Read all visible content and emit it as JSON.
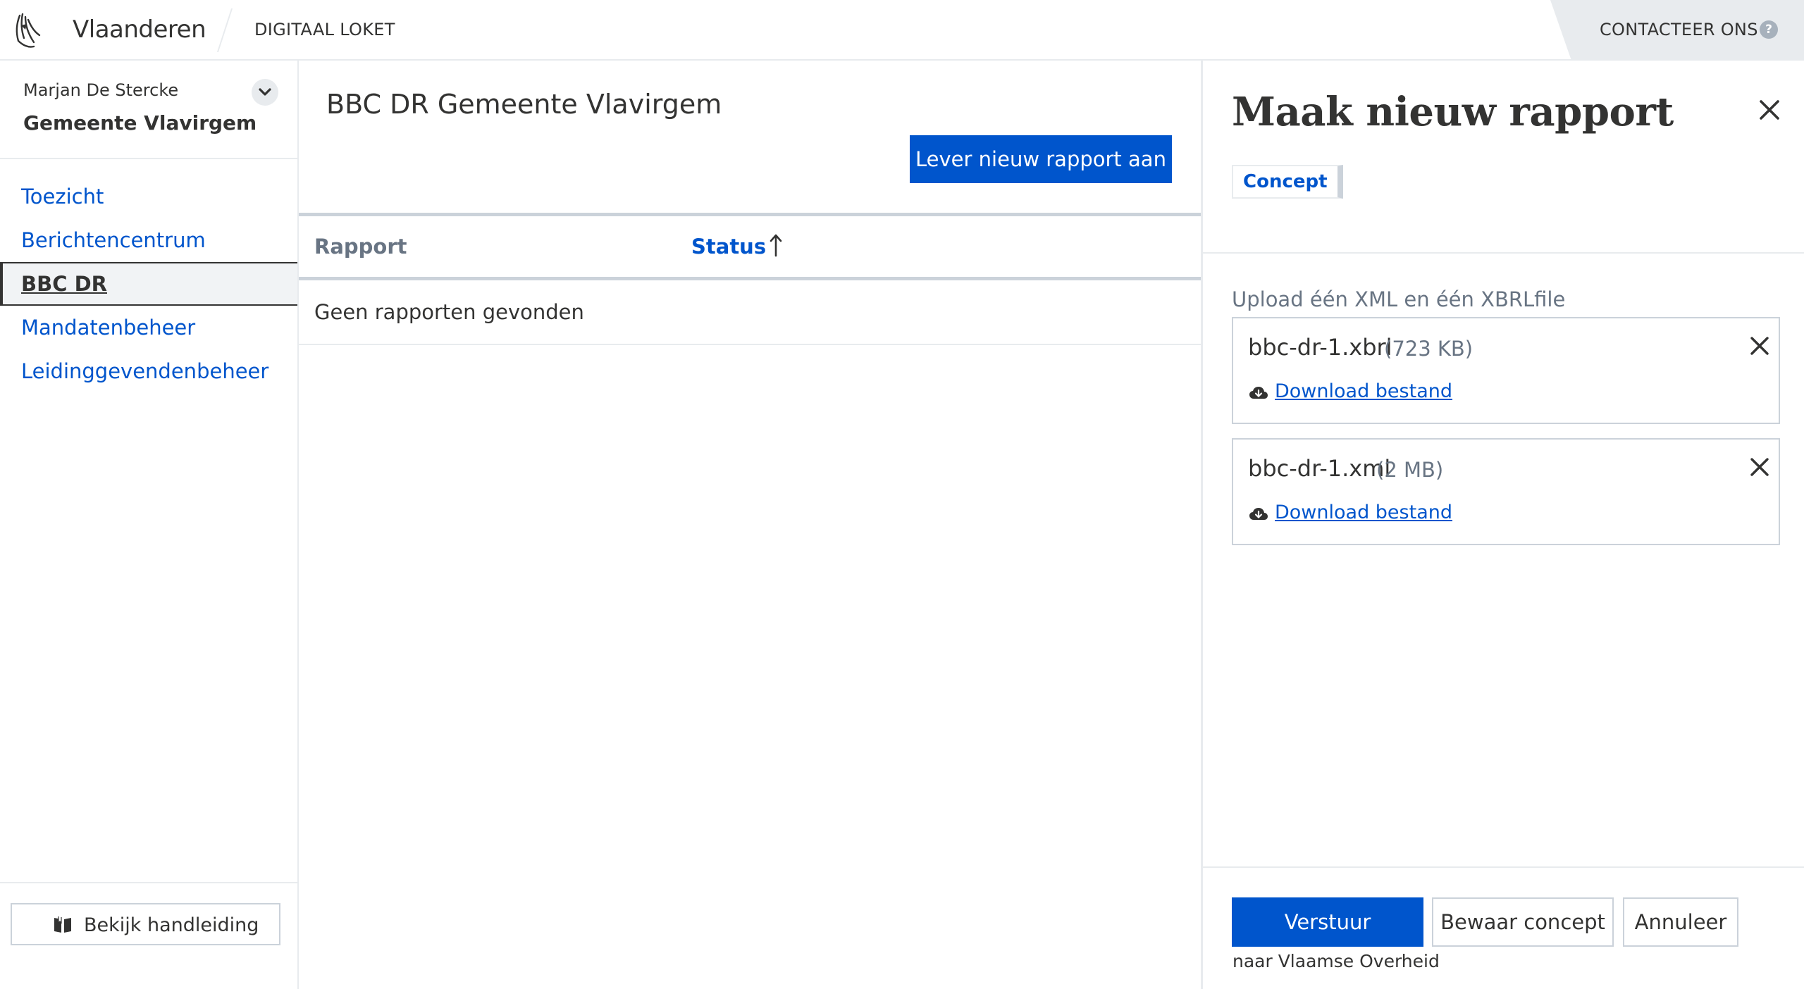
{
  "header": {
    "brand": "Vlaanderen",
    "app_name": "DIGITAAL LOKET",
    "contact_label": "CONTACTEER ONS",
    "help_glyph": "?"
  },
  "sidebar": {
    "user_name": "Marjan De Stercke",
    "org_name": "Gemeente Vlavirgem",
    "nav": [
      {
        "label": "Toezicht",
        "active": false
      },
      {
        "label": "Berichtencentrum",
        "active": false
      },
      {
        "label": "BBC DR",
        "active": true
      },
      {
        "label": "Mandatenbeheer",
        "active": false
      },
      {
        "label": "Leidinggevendenbeheer",
        "active": false
      }
    ],
    "guide_label": "Bekijk handleiding"
  },
  "main": {
    "title": "BBC DR Gemeente Vlavirgem",
    "new_report_label": "Lever nieuw rapport aan",
    "columns": [
      "Rapport",
      "Status"
    ],
    "sort_direction": "ascending",
    "empty_message": "Geen rapporten gevonden"
  },
  "panel": {
    "title": "Maak nieuw rapport",
    "status_pill": "Concept",
    "upload_label": "Upload één XML en één XBRLfile",
    "files": [
      {
        "name": "bbc-dr-1.xbrl",
        "size": "(723 KB)",
        "download_label": "Download bestand"
      },
      {
        "name": "bbc-dr-1.xml",
        "size": "(2 MB)",
        "download_label": "Download bestand"
      }
    ],
    "send_label": "Verstuur",
    "send_sublabel": "naar Vlaamse Overheid",
    "save_label": "Bewaar concept",
    "cancel_label": "Annuleer"
  },
  "colors": {
    "primary": "#0055cc",
    "text": "#333332",
    "muted": "#687483",
    "border": "#cbd2da",
    "light_border": "#e8ebee"
  },
  "icons": [
    "lion-logo-icon",
    "help-icon",
    "chevron-down-icon",
    "book-icon",
    "sort-arrow-up-icon",
    "close-icon",
    "cloud-download-icon"
  ]
}
